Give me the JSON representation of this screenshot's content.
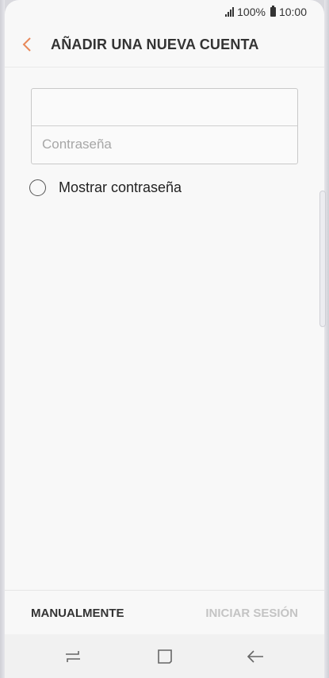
{
  "status_bar": {
    "battery_percent": "100%",
    "time": "10:00"
  },
  "header": {
    "back_icon": "chevron-left-icon",
    "title": "AÑADIR UNA NUEVA CUENTA"
  },
  "form": {
    "email_value": "",
    "email_placeholder": "",
    "password_value": "",
    "password_placeholder": "Contraseña"
  },
  "show_password": {
    "label": "Mostrar contraseña",
    "checked": false
  },
  "actions": {
    "manual_label": "MANUALMENTE",
    "login_label": "INICIAR SESIÓN",
    "login_enabled": false
  },
  "nav": {
    "recents_icon": "recents-icon",
    "home_icon": "home-icon",
    "back_icon": "back-arrow-icon"
  },
  "colors": {
    "accent": "#e8895a",
    "background": "#f8f8f8",
    "disabled_text": "#c4c4c4"
  }
}
